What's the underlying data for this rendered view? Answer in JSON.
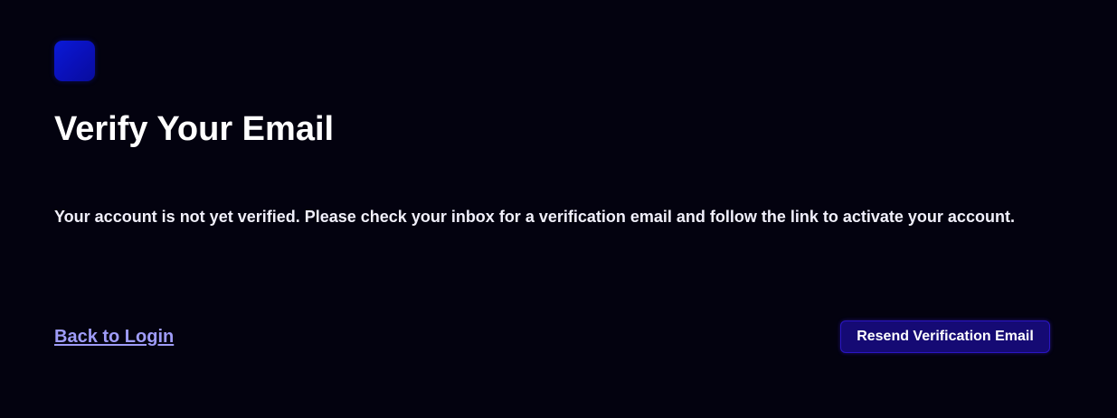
{
  "colors": {
    "background": "#03020f",
    "logo": "#0a10b8",
    "link": "#9f9cf8",
    "button_bg": "#150a74",
    "button_border": "#2a15c4"
  },
  "logo": {
    "icon": "app-logo-square"
  },
  "verify": {
    "title": "Verify Your Email",
    "message": "Your account is not yet verified. Please check your inbox for a verification email and follow the link to activate your account."
  },
  "actions": {
    "back_label": "Back to Login",
    "resend_label": "Resend Verification Email"
  }
}
